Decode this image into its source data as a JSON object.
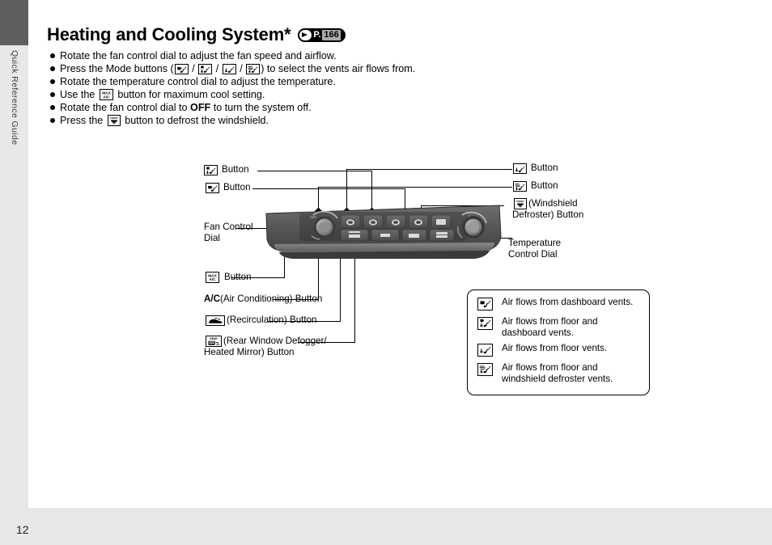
{
  "sidebar": {
    "label": "Quick Reference Guide"
  },
  "footer": {
    "page_number": "12"
  },
  "heading": {
    "title": "Heating and Cooling System*",
    "ref_prefix": "P.",
    "ref_page": "166"
  },
  "bullets": [
    {
      "id": "fan-control-dial",
      "segments": [
        {
          "type": "text",
          "text": "Rotate the fan control dial to adjust the fan speed and airflow."
        }
      ]
    },
    {
      "id": "mode-buttons",
      "segments": [
        {
          "type": "text",
          "text": "Press the Mode buttons ("
        },
        {
          "type": "icon",
          "icon": "vent-dash-icon"
        },
        {
          "type": "text",
          "text": " / "
        },
        {
          "type": "icon",
          "icon": "vent-floor-dash-icon"
        },
        {
          "type": "text",
          "text": " / "
        },
        {
          "type": "icon",
          "icon": "vent-floor-icon"
        },
        {
          "type": "text",
          "text": " / "
        },
        {
          "type": "icon",
          "icon": "vent-floor-defrost-icon"
        },
        {
          "type": "text",
          "text": ") to select the vents air flows from."
        }
      ]
    },
    {
      "id": "temperature-control-dial",
      "segments": [
        {
          "type": "text",
          "text": "Rotate the temperature control dial to adjust the temperature."
        }
      ]
    },
    {
      "id": "max-ac",
      "segments": [
        {
          "type": "text",
          "text": "Use the "
        },
        {
          "type": "icon",
          "icon": "max-ac-icon"
        },
        {
          "type": "text",
          "text": " button for maximum cool setting."
        }
      ]
    },
    {
      "id": "system-off",
      "segments": [
        {
          "type": "text",
          "text": "Rotate the fan control dial to "
        },
        {
          "type": "bold",
          "text": "OFF"
        },
        {
          "type": "text",
          "text": " to turn the system off."
        }
      ]
    },
    {
      "id": "windshield-defrost",
      "segments": [
        {
          "type": "text",
          "text": "Press the "
        },
        {
          "type": "icon",
          "icon": "windshield-defroster-icon"
        },
        {
          "type": "text",
          "text": " button to defrost the windshield."
        }
      ]
    }
  ],
  "callouts": {
    "left": [
      {
        "id": "vent-floor-dash-button",
        "icon": "vent-floor-dash-icon",
        "text": "Button"
      },
      {
        "id": "vent-dash-button",
        "icon": "vent-dash-icon",
        "text": "Button"
      },
      {
        "id": "fan-control-dial",
        "icon": null,
        "text": "Fan Control",
        "text2": "Dial"
      },
      {
        "id": "max-ac-button",
        "icon": "max-ac-icon",
        "text": "Button"
      },
      {
        "id": "ac-button",
        "icon": null,
        "bold": "A/C",
        "text": " (Air Conditioning) Button"
      },
      {
        "id": "recirculation-button",
        "icon": "recirculation-icon",
        "text": " (Recirculation) Button"
      },
      {
        "id": "rear-window-defogger-button",
        "icon": "rear-defogger-icon",
        "text": " (Rear Window Defogger/",
        "text2": "Heated Mirror) Button"
      }
    ],
    "right": [
      {
        "id": "vent-floor-button",
        "icon": "vent-floor-icon",
        "text": "Button"
      },
      {
        "id": "vent-floor-defrost-button",
        "icon": "vent-floor-defrost-icon",
        "text": "Button"
      },
      {
        "id": "windshield-defroster-button",
        "icon": "windshield-defroster-icon",
        "text": " (Windshield",
        "text2": "Defroster) Button"
      },
      {
        "id": "temperature-control-dial",
        "icon": null,
        "text": "Temperature",
        "text2": "Control Dial"
      }
    ]
  },
  "legend": {
    "items": [
      {
        "icon": "vent-dash-icon",
        "text": "Air flows from dashboard vents."
      },
      {
        "icon": "vent-floor-dash-icon",
        "text": "Air flows from floor and dashboard vents."
      },
      {
        "icon": "vent-floor-icon",
        "text": "Air flows from floor vents."
      },
      {
        "icon": "vent-floor-defrost-icon",
        "text": "Air flows from floor and windshield defroster vents."
      }
    ]
  },
  "colors": {
    "page_background": "#ffffff",
    "band_gray": "#e8e8e8",
    "sidebar_dark": "#5e5e5e",
    "panel_dark": "#4a4a4a",
    "ink": "#000000"
  }
}
